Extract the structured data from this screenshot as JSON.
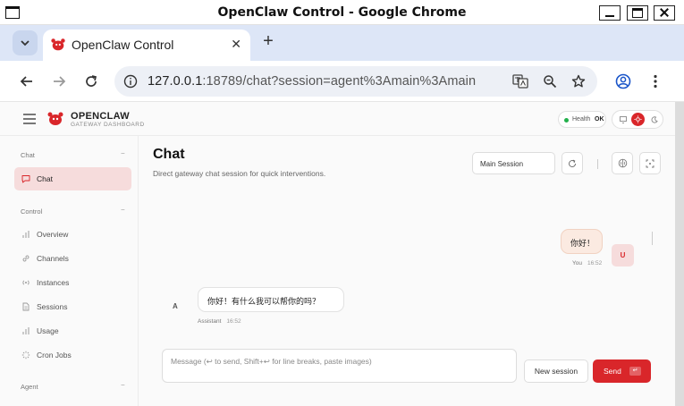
{
  "window": {
    "title": "OpenClaw Control - Google Chrome"
  },
  "browser": {
    "tab_title": "OpenClaw Control",
    "tab_close": "✕",
    "new_tab": "+",
    "url_host": "127.0.0.1",
    "url_rest": ":18789/chat?session=agent%3Amain%3Amain"
  },
  "app": {
    "brand_name": "OPENCLAW",
    "brand_sub": "GATEWAY DASHBOARD",
    "health_label": "Health",
    "health_value": "OK",
    "accent_color": "#d9262a"
  },
  "sidebar": {
    "groups": [
      {
        "label": "Chat",
        "collapse": "−"
      },
      {
        "label": "Control",
        "collapse": "−"
      },
      {
        "label": "Agent",
        "collapse": "−"
      }
    ],
    "items": [
      {
        "label": "Chat",
        "icon": "chat-bubble-icon"
      },
      {
        "label": "Overview",
        "icon": "bar-chart-icon"
      },
      {
        "label": "Channels",
        "icon": "link-icon"
      },
      {
        "label": "Instances",
        "icon": "radio-icon"
      },
      {
        "label": "Sessions",
        "icon": "document-icon"
      },
      {
        "label": "Usage",
        "icon": "bar-chart-icon"
      },
      {
        "label": "Cron Jobs",
        "icon": "loader-icon"
      }
    ]
  },
  "main": {
    "title": "Chat",
    "subtitle": "Direct gateway chat session for quick interventions.",
    "session_select": "Main Session",
    "messages": [
      {
        "role": "user",
        "text": "你好！",
        "avatar": "U",
        "author": "You",
        "time": "16:52"
      },
      {
        "role": "assistant",
        "text": "你好！有什么我可以帮你的吗？",
        "avatar": "A",
        "author": "Assistant",
        "time": "16:52"
      }
    ],
    "composer_placeholder": "Message (↩ to send, Shift+↩ for line breaks, paste images)",
    "new_session_label": "New session",
    "send_label": "Send",
    "send_kbd": "↵"
  }
}
